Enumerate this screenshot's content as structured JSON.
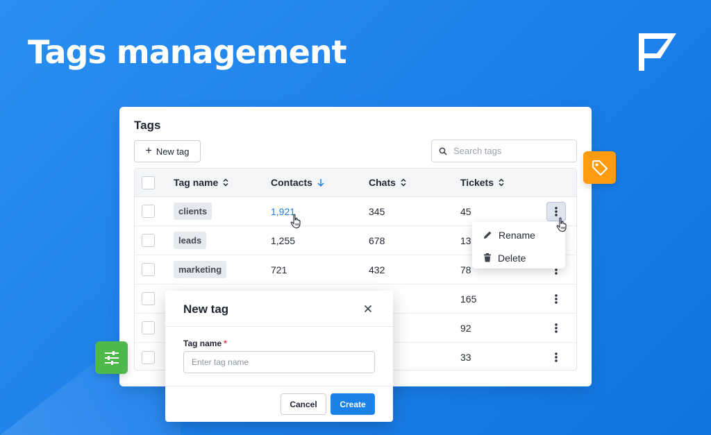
{
  "hero": {
    "title": "Tags management"
  },
  "card": {
    "title": "Tags",
    "new_tag_label": "New tag",
    "search_placeholder": "Search tags"
  },
  "table": {
    "columns": [
      "Tag name",
      "Contacts",
      "Chats",
      "Tickets"
    ],
    "rows": [
      {
        "tag": "clients",
        "contacts": "1,921",
        "chats": "345",
        "tickets": "45"
      },
      {
        "tag": "leads",
        "contacts": "1,255",
        "chats": "678",
        "tickets": "13"
      },
      {
        "tag": "marketing",
        "contacts": "721",
        "chats": "432",
        "tickets": "78"
      },
      {
        "tag": "",
        "contacts": "",
        "chats": "",
        "tickets": "165"
      },
      {
        "tag": "",
        "contacts": "",
        "chats": "",
        "tickets": "92"
      },
      {
        "tag": "",
        "contacts": "",
        "chats": "",
        "tickets": "33"
      }
    ]
  },
  "context_menu": {
    "rename": "Rename",
    "delete": "Delete"
  },
  "modal": {
    "title": "New tag",
    "field_label": "Tag name",
    "required_mark": "*",
    "field_placeholder": "Enter tag name",
    "cancel_label": "Cancel",
    "create_label": "Create"
  },
  "colors": {
    "background": "#1e82ec",
    "accent": "#1a82e8",
    "tag_badge": "#ff9b0f",
    "filter_badge": "#4fb84a"
  },
  "icons": [
    "logo-icon",
    "plus-icon",
    "search-icon",
    "sort-icon",
    "sort-desc-icon",
    "kebab-icon",
    "pencil-icon",
    "trash-icon",
    "close-icon",
    "tag-icon",
    "filter-icon",
    "hand-cursor-icon"
  ]
}
